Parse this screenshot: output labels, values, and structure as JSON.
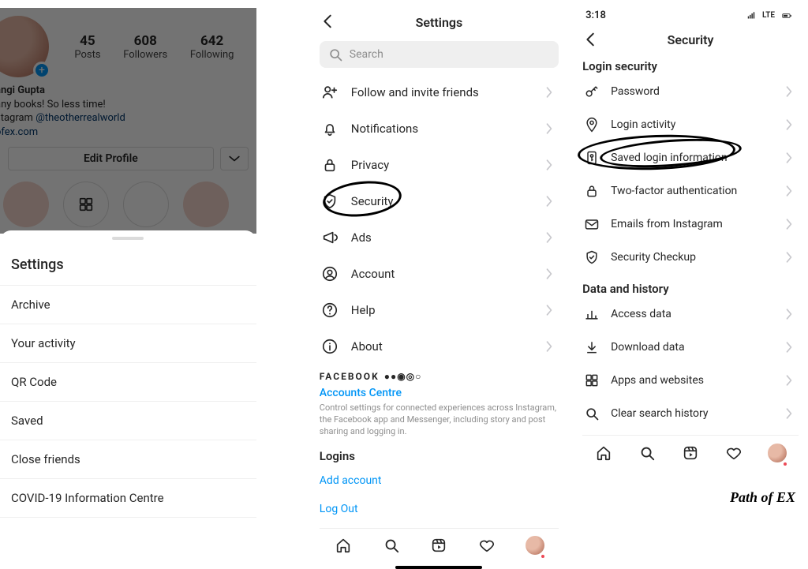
{
  "watermark": "Path of EX",
  "phone1": {
    "stats": [
      {
        "n": "45",
        "l": "Posts"
      },
      {
        "n": "608",
        "l": "Followers"
      },
      {
        "n": "642",
        "l": "Following"
      }
    ],
    "bio": {
      "name": "angi Gupta",
      "line1": "any books! So less time!",
      "line2_prefix": "stagram ",
      "line2_handle": "@theotherrealworld",
      "line3": "ofex.com"
    },
    "edit_label": "Edit Profile",
    "drawer": [
      "Settings",
      "Archive",
      "Your activity",
      "QR Code",
      "Saved",
      "Close friends",
      "COVID-19 Information Centre"
    ]
  },
  "phone2": {
    "title": "Settings",
    "search_placeholder": "Search",
    "items": [
      "Follow and invite friends",
      "Notifications",
      "Privacy",
      "Security",
      "Ads",
      "Account",
      "Help",
      "About"
    ],
    "facebook": {
      "brand": "FACEBOOK",
      "link": "Accounts Centre",
      "desc": "Control settings for connected experiences across Instagram, the Facebook app and Messenger, including story and post sharing and logging in."
    },
    "logins": {
      "head": "Logins",
      "add": "Add account",
      "logout": "Log Out"
    }
  },
  "phone3": {
    "time": "3:18",
    "net": "LTE",
    "title": "Security",
    "section1": "Login security",
    "items1": [
      "Password",
      "Login activity",
      "Saved login information",
      "Two-factor authentication",
      "Emails from Instagram",
      "Security Checkup"
    ],
    "section2": "Data and history",
    "items2": [
      "Access data",
      "Download data",
      "Apps and websites",
      "Clear search history"
    ]
  }
}
